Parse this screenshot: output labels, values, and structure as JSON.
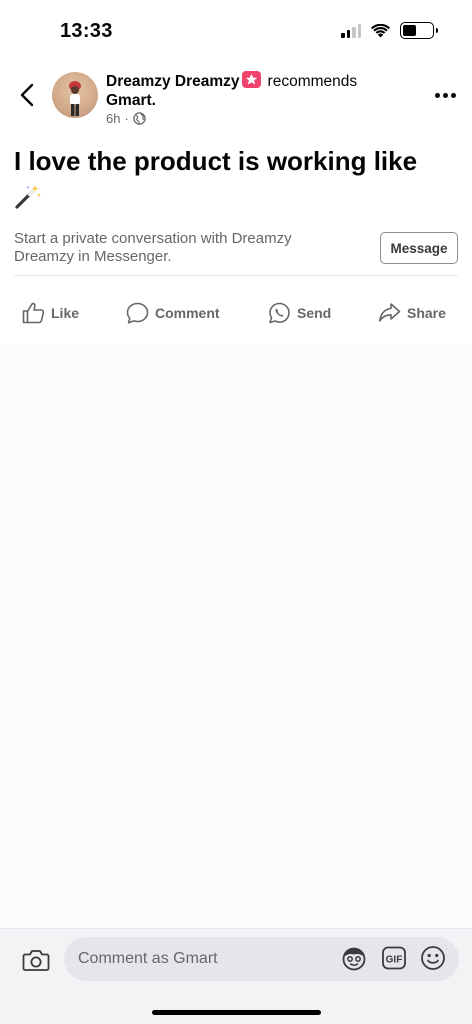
{
  "status_bar": {
    "time": "13:33",
    "icons": [
      "signal-icon",
      "wifi-icon",
      "battery-icon"
    ]
  },
  "post": {
    "author": "Dreamzy Dreamzy",
    "badge_icon": "top-fan-star-badge-icon",
    "action_text": "recommends",
    "page": "Gmart.",
    "age": "6h",
    "separator": "·",
    "privacy_icon": "globe-icon",
    "text": "I love the product is working like",
    "emoji_icon": "magic-wand-icon"
  },
  "messenger_prompt": {
    "text": "Start a private conversation with Dreamzy Dreamzy in Messenger.",
    "button_label": "Message"
  },
  "actions": [
    {
      "label": "Like",
      "icon": "thumbs-up-icon"
    },
    {
      "label": "Comment",
      "icon": "comment-bubble-icon"
    },
    {
      "label": "Send",
      "icon": "whatsapp-icon"
    },
    {
      "label": "Share",
      "icon": "share-arrow-icon"
    }
  ],
  "comment_bar": {
    "placeholder": "Comment as Gmart",
    "icons": [
      "camera-icon",
      "avatar-sticker-icon",
      "gif-icon",
      "emoji-icon"
    ],
    "gif_label": "GIF"
  },
  "colors": {
    "text_primary": "#050505",
    "text_secondary": "#65676b",
    "badge": "#f0426b",
    "background": "#ffffff",
    "input_bg": "#e4e6eb"
  }
}
